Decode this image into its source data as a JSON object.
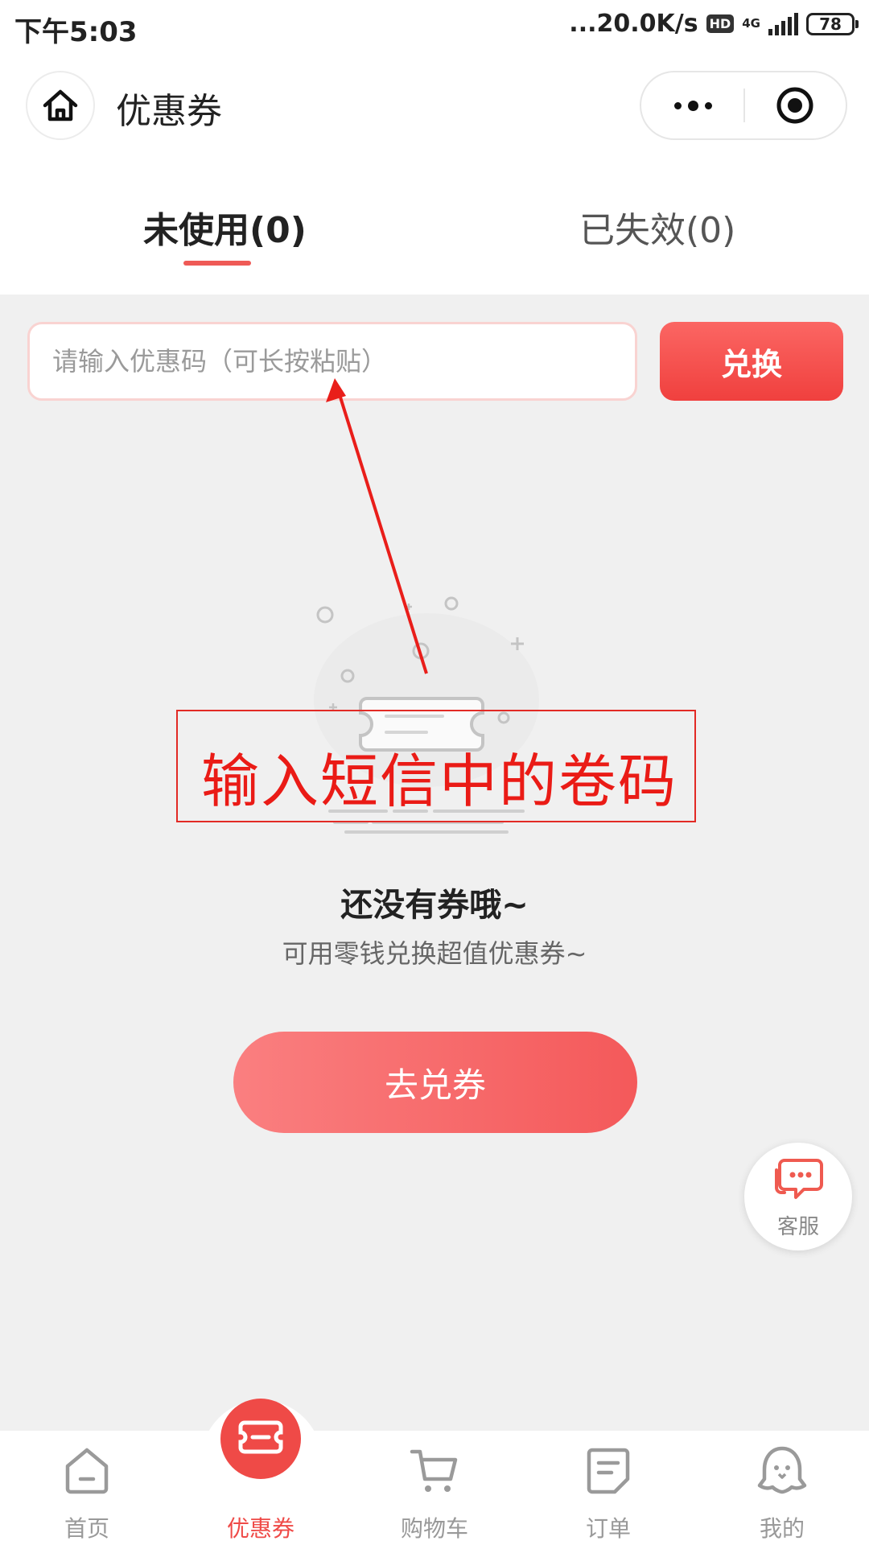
{
  "status_bar": {
    "time": "下午5:03",
    "network_speed": "...20.0K/s",
    "hd": "HD",
    "network_type": "4G",
    "battery": "78"
  },
  "nav": {
    "title": "优惠券",
    "icons": [
      "home-icon",
      "more-dots-icon",
      "target-close-icon"
    ]
  },
  "tabs": [
    {
      "label": "未使用(0)",
      "active": true
    },
    {
      "label": "已失效(0)",
      "active": false
    }
  ],
  "redeem": {
    "placeholder": "请输入优惠码（可长按粘贴）",
    "value": "",
    "button": "兑换"
  },
  "annotation": {
    "text": "输入短信中的卷码",
    "color": "#ea1b16"
  },
  "empty_state": {
    "title": "还没有券哦~",
    "subtitle": "可用零钱兑换超值优惠券~",
    "button": "去兑券"
  },
  "customer_service": {
    "label": "客服",
    "icon": "chat-bubble-icon"
  },
  "bottom_tabs": [
    {
      "label": "首页",
      "icon": "home-tab-icon",
      "active": false
    },
    {
      "label": "优惠券",
      "icon": "coupon-tab-icon",
      "active": true
    },
    {
      "label": "购物车",
      "icon": "cart-tab-icon",
      "active": false
    },
    {
      "label": "订单",
      "icon": "order-tab-icon",
      "active": false
    },
    {
      "label": "我的",
      "icon": "profile-tab-icon",
      "active": false
    }
  ],
  "colors": {
    "accent": "#ef4a47",
    "background": "#f0f0f0",
    "button_gradient_start": "#fa7f80",
    "button_gradient_end": "#f4595a"
  }
}
